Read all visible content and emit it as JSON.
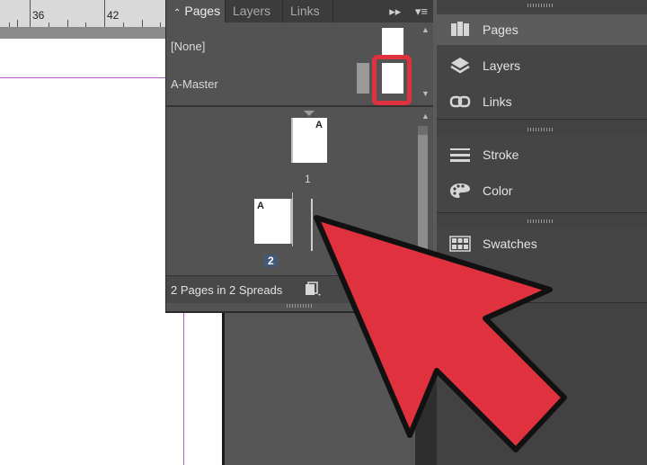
{
  "ruler": {
    "marks": [
      "36",
      "42"
    ]
  },
  "pages_panel": {
    "tabs": [
      {
        "label": "Pages",
        "prefix": "⌃⌄"
      },
      {
        "label": "Layers"
      },
      {
        "label": "Links"
      }
    ],
    "masters": [
      {
        "label": "[None]"
      },
      {
        "label": "A-Master"
      }
    ],
    "pages": [
      {
        "number": "1",
        "master_prefix": "A"
      },
      {
        "number": "2",
        "master_prefix": "A"
      }
    ],
    "footer_text": "2 Pages in 2 Spreads"
  },
  "dock": {
    "items": [
      {
        "label": "Pages",
        "icon": "pages-icon"
      },
      {
        "label": "Layers",
        "icon": "layers-icon"
      },
      {
        "label": "Links",
        "icon": "links-icon"
      },
      {
        "label": "Stroke",
        "icon": "stroke-icon"
      },
      {
        "label": "Color",
        "icon": "color-palette-icon"
      },
      {
        "label": "Swatches",
        "icon": "swatches-icon"
      }
    ]
  },
  "colors": {
    "highlight_box": "#e0323e",
    "arrow_fill": "#e0323e",
    "selection": "#425a78"
  }
}
